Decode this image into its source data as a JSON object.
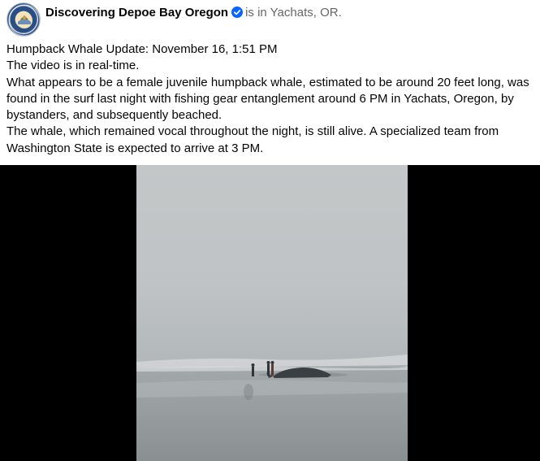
{
  "post": {
    "page_name": "Discovering Depoe Bay Oregon",
    "location_prefix": "is in",
    "location": "Yachats, OR.",
    "lines": [
      "Humpback Whale Update: November 16, 1:51 PM",
      "The video is in real-time.",
      "What appears to be a female juvenile humpback whale, estimated to be around 20 feet long, was found in the surf last night with fishing gear entanglement around 6 PM in Yachats, Oregon, by bystanders, and subsequently beached.",
      "The whale, which remained vocal throughout the night, is still alive. A specialized team from Washington State is expected to arrive at 3 PM."
    ]
  },
  "icons": {
    "avatar": "page-logo",
    "verified": "verified-badge-icon"
  },
  "colors": {
    "verified": "#0866ff",
    "secondary_text": "#65676b",
    "primary_text": "#050505",
    "video_background": "#000000"
  }
}
